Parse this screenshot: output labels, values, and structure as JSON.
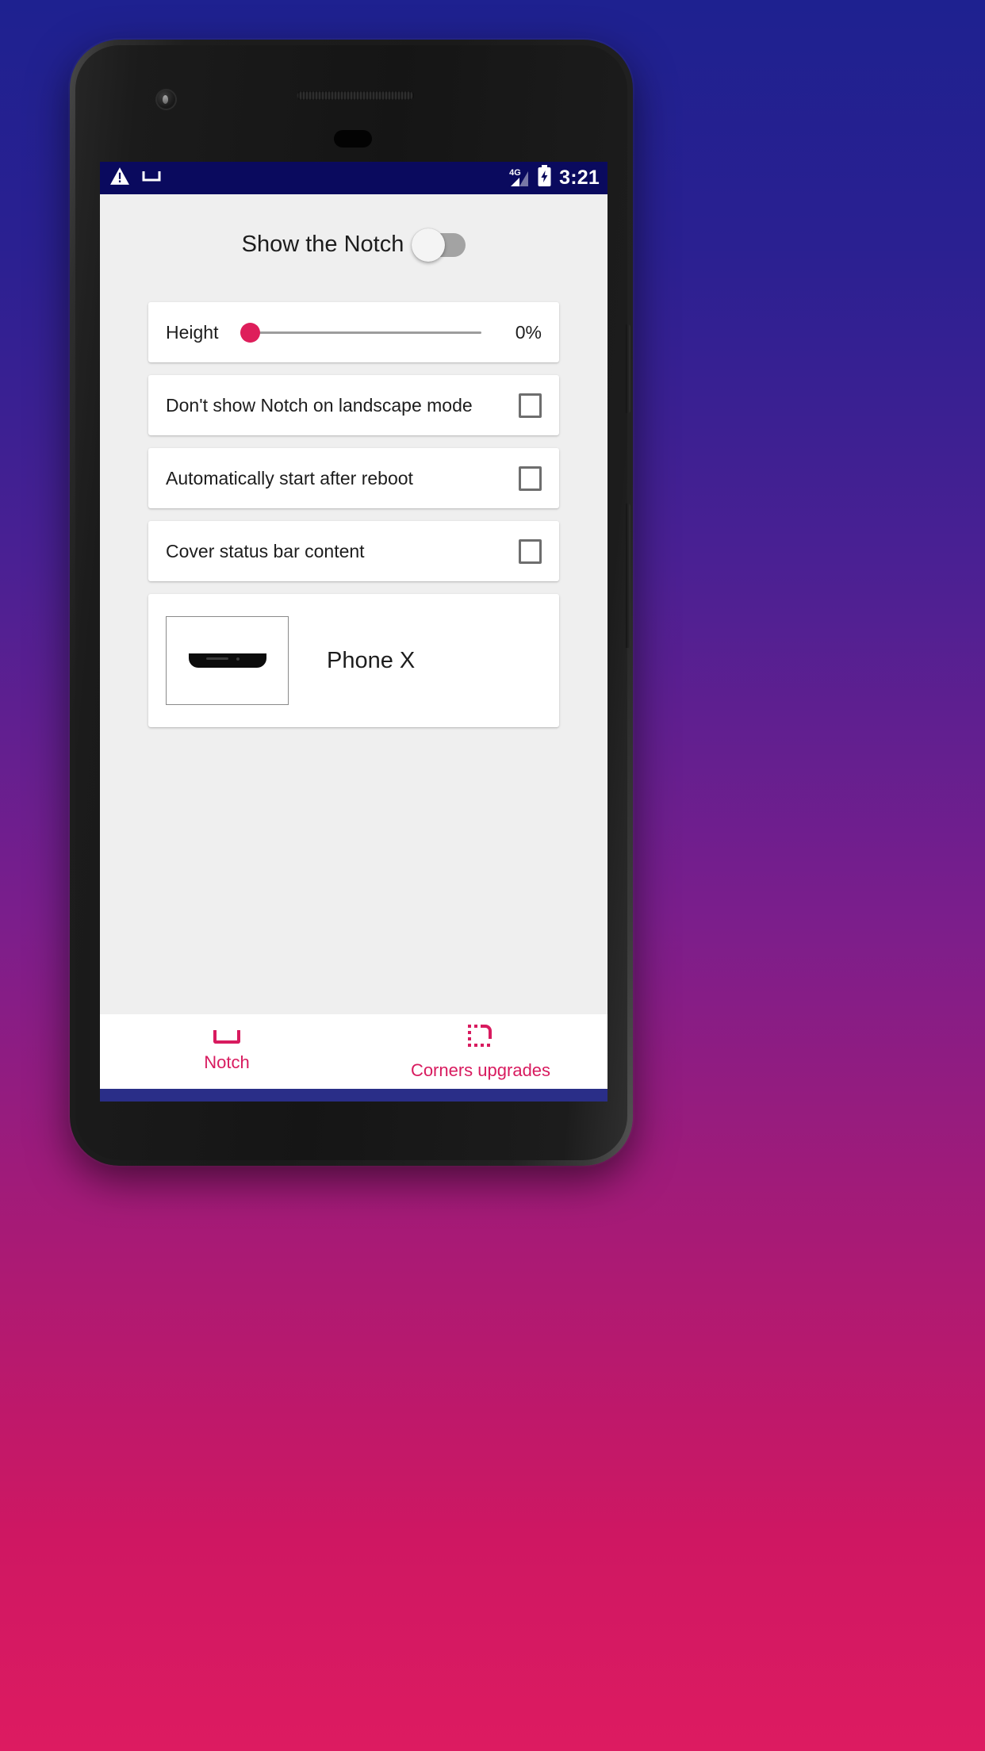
{
  "wallpaper": {
    "gradient_top": "#1E2190",
    "gradient_bottom": "#DD1B61"
  },
  "device": {
    "frame_color": "#1a1a1a",
    "front_camera_icon": "front-camera-icon",
    "earpiece_icon": "earpiece-speaker-icon",
    "proximity_icon": "proximity-sensor-icon"
  },
  "status_bar": {
    "background": "#0A0A5E",
    "warning_icon": "warning-triangle-icon",
    "notch_notification_icon": "notch-notification-icon",
    "network_label": "4G",
    "signal_icon": "signal-bars-icon",
    "battery_icon": "battery-charging-icon",
    "clock": "3:21"
  },
  "header": {
    "title": "Show the Notch",
    "toggle_name": "show-notch-toggle",
    "toggle_state": "off"
  },
  "cards": {
    "height": {
      "label": "Height",
      "value_text": "0%",
      "slider_percent": 0,
      "accent_color": "#DE1E5B",
      "track_color": "#9C9C9C"
    },
    "checkboxes": [
      {
        "label": "Don't show Notch on landscape mode",
        "checked": false,
        "name": "landscape-mode-checkbox"
      },
      {
        "label": "Automatically start after reboot",
        "checked": false,
        "name": "auto-start-checkbox"
      },
      {
        "label": "Cover status bar content",
        "checked": false,
        "name": "cover-status-bar-checkbox"
      }
    ],
    "device_select": {
      "name": "Phone X",
      "preview_icon": "notch-preview-icon"
    }
  },
  "tab_bar": {
    "accent_color": "#D81B5F",
    "tabs": [
      {
        "label": "Notch",
        "icon": "notch-icon",
        "active": true
      },
      {
        "label": "Corners upgrades",
        "icon": "rounded-corner-icon",
        "active": false
      }
    ]
  },
  "nav_bar": {
    "background": "#2A2E88",
    "back_icon": "back-triangle-icon",
    "home_icon": "home-circle-icon",
    "recents_icon": "recents-square-icon"
  }
}
